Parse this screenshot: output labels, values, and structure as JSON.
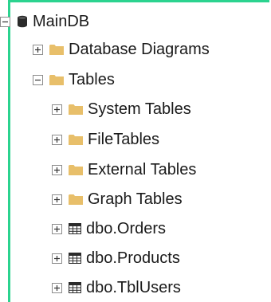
{
  "tree": {
    "nodes": [
      {
        "label": "MainDB",
        "icon": "database-icon",
        "state": "expanded"
      },
      {
        "label": "Database Diagrams",
        "icon": "folder-icon",
        "state": "collapsed"
      },
      {
        "label": "Tables",
        "icon": "folder-icon",
        "state": "expanded"
      },
      {
        "label": "System Tables",
        "icon": "folder-icon",
        "state": "collapsed"
      },
      {
        "label": "FileTables",
        "icon": "folder-icon",
        "state": "collapsed"
      },
      {
        "label": "External Tables",
        "icon": "folder-icon",
        "state": "collapsed"
      },
      {
        "label": "Graph Tables",
        "icon": "folder-icon",
        "state": "collapsed"
      },
      {
        "label": "dbo.Orders",
        "icon": "table-icon",
        "state": "collapsed"
      },
      {
        "label": "dbo.Products",
        "icon": "table-icon",
        "state": "collapsed"
      },
      {
        "label": "dbo.TblUsers",
        "icon": "table-icon",
        "state": "collapsed"
      }
    ]
  },
  "colors": {
    "frame": "#2bd38f",
    "folder": "#e8bf6a",
    "text": "#1a1a1a",
    "toggle_border": "#8c8c8c"
  }
}
